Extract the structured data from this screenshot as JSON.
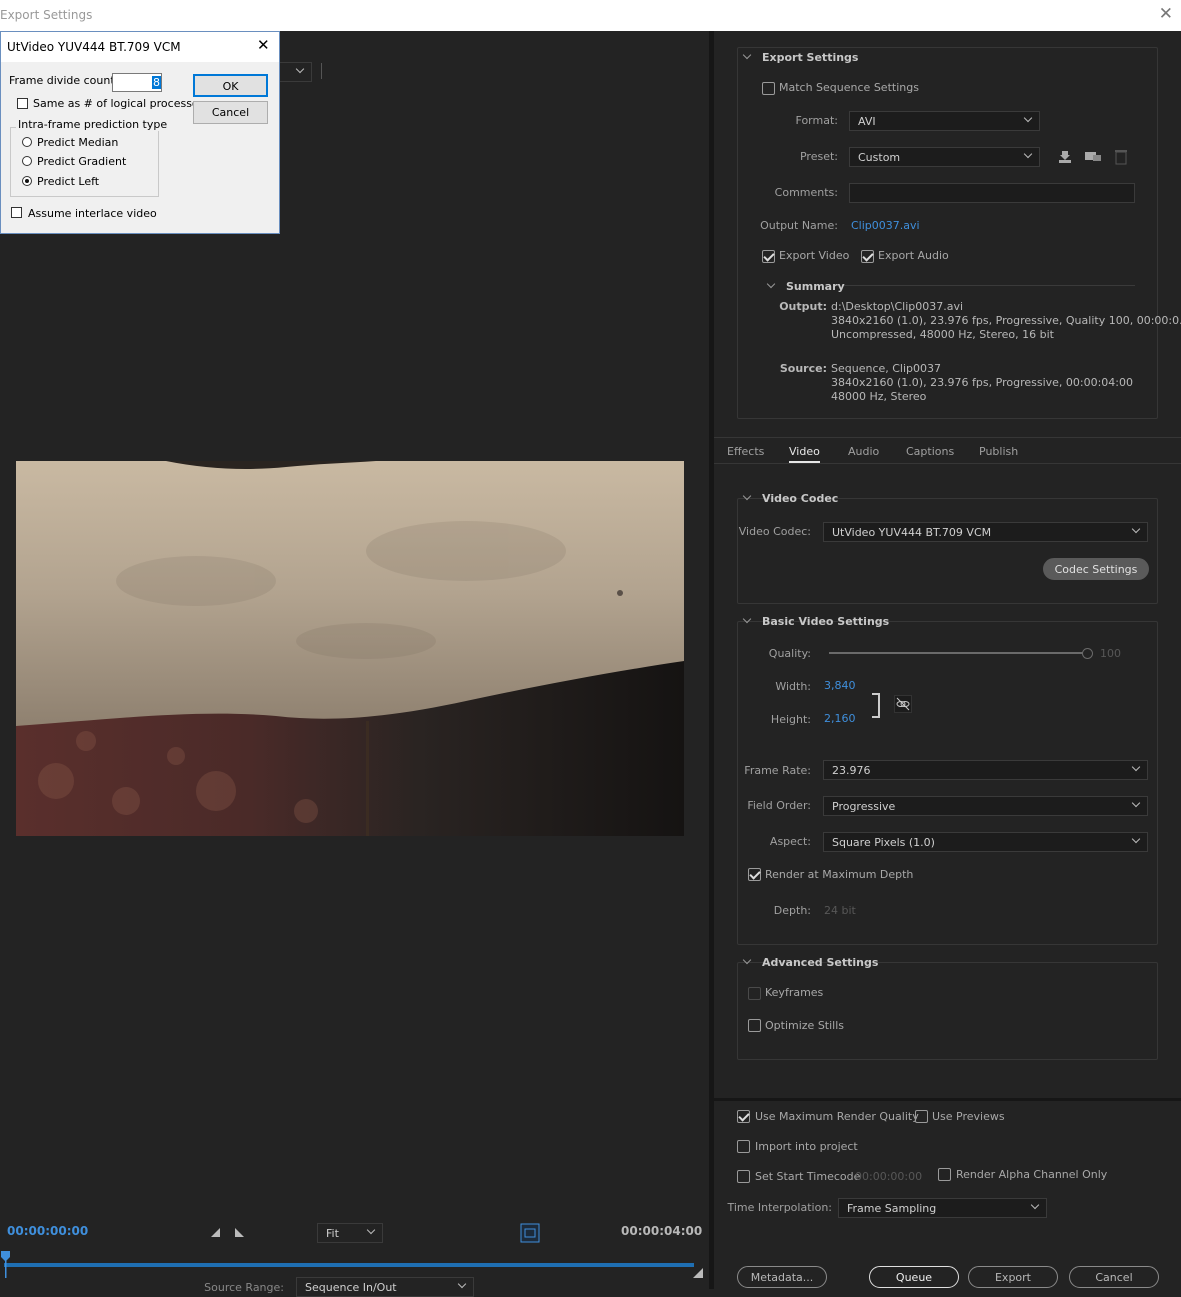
{
  "window": {
    "title": "Export Settings"
  },
  "dialog": {
    "title": "UtVideo YUV444 BT.709 VCM",
    "frame_divide_label": "Frame divide count",
    "frame_divide_value": "8",
    "same_as_label": "Same as # of logical processors",
    "group_label": "Intra-frame prediction type",
    "predict_median": "Predict Median",
    "predict_gradient": "Predict Gradient",
    "predict_left": "Predict Left",
    "selected": "Predict Left",
    "interlace_label": "Assume interlace video",
    "ok": "OK",
    "cancel": "Cancel"
  },
  "export_settings": {
    "header": "Export Settings",
    "match_sequence": "Match Sequence Settings",
    "format_label": "Format:",
    "format_value": "AVI",
    "preset_label": "Preset:",
    "preset_value": "Custom",
    "comments_label": "Comments:",
    "comments_value": "",
    "output_name_label": "Output Name:",
    "output_name_value": "Clip0037.avi",
    "export_video": "Export Video",
    "export_audio": "Export Audio",
    "summary": {
      "header": "Summary",
      "output_label": "Output:",
      "output_lines": [
        "d:\\Desktop\\Clip0037.avi",
        "3840x2160 (1.0), 23.976 fps, Progressive, Quality 100, 00:00:0...",
        "Uncompressed, 48000 Hz, Stereo, 16 bit"
      ],
      "source_label": "Source:",
      "source_lines": [
        "Sequence, Clip0037",
        "3840x2160 (1.0), 23.976 fps, Progressive, 00:00:04:00",
        "48000 Hz, Stereo"
      ]
    }
  },
  "tabs": [
    "Effects",
    "Video",
    "Audio",
    "Captions",
    "Publish"
  ],
  "active_tab": "Video",
  "video_codec": {
    "header": "Video Codec",
    "label": "Video Codec:",
    "value": "UtVideo YUV444 BT.709 VCM",
    "codec_settings": "Codec Settings"
  },
  "basic_video": {
    "header": "Basic Video Settings",
    "quality_label": "Quality:",
    "quality_value": "100",
    "quality_fraction": 1.0,
    "width_label": "Width:",
    "width_value": "3,840",
    "height_label": "Height:",
    "height_value": "2,160",
    "frame_rate_label": "Frame Rate:",
    "frame_rate_value": "23.976",
    "field_order_label": "Field Order:",
    "field_order_value": "Progressive",
    "aspect_label": "Aspect:",
    "aspect_value": "Square Pixels (1.0)",
    "render_max_depth": "Render at Maximum Depth",
    "depth_label": "Depth:",
    "depth_value": "24 bit"
  },
  "advanced": {
    "header": "Advanced Settings",
    "keyframes": "Keyframes",
    "optimize_stills": "Optimize Stills"
  },
  "bottom": {
    "use_max_render": "Use Maximum Render Quality",
    "use_previews": "Use Previews",
    "import_project": "Import into project",
    "set_start_tc": "Set Start Timecode",
    "start_tc_value": "00:00:00:00",
    "render_alpha": "Render Alpha Channel Only",
    "time_interp_label": "Time Interpolation:",
    "time_interp_value": "Frame Sampling",
    "metadata": "Metadata...",
    "queue": "Queue",
    "export": "Export",
    "cancel": "Cancel"
  },
  "player": {
    "timecode_start": "00:00:00:00",
    "timecode_end": "00:00:04:00",
    "fit": "Fit",
    "source_range_label": "Source Range:",
    "source_range_value": "Sequence In/Out"
  }
}
